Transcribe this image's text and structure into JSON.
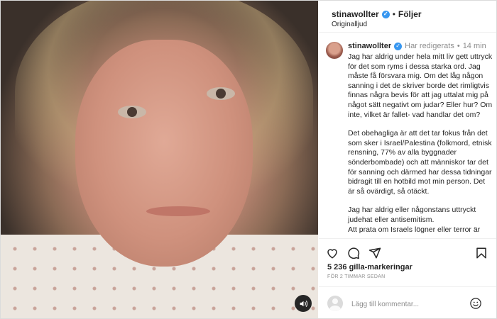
{
  "header": {
    "username": "stinawollter",
    "separator": "•",
    "follow_label": "Följer",
    "audio_label": "Originalljud"
  },
  "caption": {
    "username": "stinawollter",
    "edited_label": "Har redigerats",
    "separator": "•",
    "time": "14 min",
    "paragraphs": [
      "Jag har aldrig under hela mitt liv gett uttryck för det som ryms i dessa starka ord. Jag måste få försvara mig. Om det låg någon sanning i det de skriver borde det rimligtvis finnas några bevis för att jag uttalat mig på något sätt negativt om judar? Eller hur? Om inte, vilket är fallet- vad handlar det om?",
      "Det obehagliga är att det tar fokus från det som sker i Israel/Palestina (folkmord, etnisk rensning, 77% av alla byggnader sönderbombade) och att människor tar det för sanning och därmed har dessa tidningar bidragit till en hotbild mot min person. Det är så ovärdigt, så otäckt.",
      "Jag har aldrig eller någonstans uttryckt judehat eller antisemitism.",
      "Att prata om Israels lögner eller terror är"
    ]
  },
  "stats": {
    "likes": "5 236 gilla-markeringar",
    "timestamp": "FÖR 2 TIMMAR SEDAN"
  },
  "comment": {
    "placeholder": "Lägg till kommentar..."
  },
  "icons": {
    "verified": "verified-badge-icon",
    "like": "heart-icon",
    "comment": "speech-bubble-icon",
    "share": "paper-plane-icon",
    "save": "bookmark-icon",
    "audio": "speaker-icon",
    "emoji": "smiley-icon"
  },
  "colors": {
    "verified_blue": "#3897f0",
    "text": "#262626",
    "muted": "#8e8e8e",
    "border": "#dbdbdb"
  }
}
